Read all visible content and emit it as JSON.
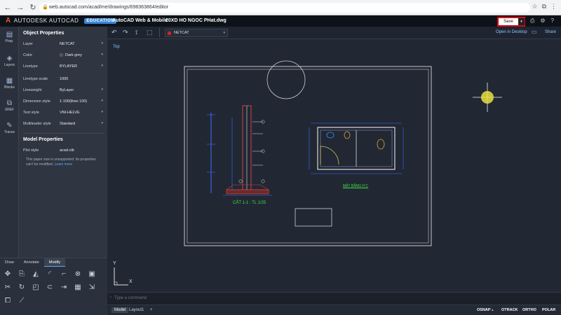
{
  "browser": {
    "url": "web.autocad.com/acad/me/drawings/698363864/editor",
    "nav_back": "←",
    "nav_forward": "→",
    "nav_reload": "↻",
    "nav_home": "⌂"
  },
  "app": {
    "brand": "AUTODESK AUTOCAD",
    "edition": "EDUCATION",
    "title": "AutoCAD Web & Mobile",
    "file": "20XD HO NGOC PHat.dwg",
    "save_label": "Save",
    "open_desktop": "Open in Desktop",
    "share": "Share"
  },
  "rail": [
    {
      "label": "Prop."
    },
    {
      "label": "Layers"
    },
    {
      "label": "Blocks"
    },
    {
      "label": "XREF"
    },
    {
      "label": "Traces"
    }
  ],
  "properties": {
    "heading": "Object Properties",
    "rows": [
      {
        "key": "Layer",
        "value": "NETCAT"
      },
      {
        "key": "Color",
        "value": "Dark grey"
      },
      {
        "key": "Linetype",
        "value": "BYLAYER"
      },
      {
        "key": "Linetype scale",
        "value": "1000"
      },
      {
        "key": "Lineweight",
        "value": "ByLayer"
      },
      {
        "key": "Dimension style",
        "value": "1-100(theo 100)"
      },
      {
        "key": "Text style",
        "value": "VNI-HELVE"
      },
      {
        "key": "Multileader style",
        "value": "Standard"
      }
    ],
    "model_heading": "Model Properties",
    "plot_key": "Plot style",
    "plot_value": "acad.ctb",
    "note": "This paper size is unsupported. Its properties can't be modified.",
    "note_link": "Learn more"
  },
  "tools": {
    "tabs": [
      "Draw",
      "Annotate",
      "Modify"
    ],
    "active_tab": "Modify"
  },
  "toolbar": {
    "layer": "NETCAT"
  },
  "canvas": {
    "view": "Top",
    "section_label": "CẮT 1-1 : TL 1/25",
    "plan_label": "MẶT BẰNG H C",
    "ucs_x": "X",
    "ucs_y": "Y"
  },
  "command": {
    "placeholder": "Type a command"
  },
  "status": {
    "tab_model": "Model",
    "tab_layout": "Layout1",
    "add_tab": "+",
    "osnap": "OSNAP",
    "otrack": "OTRACK",
    "ortho": "ORTHO",
    "polar": "POLAR"
  }
}
